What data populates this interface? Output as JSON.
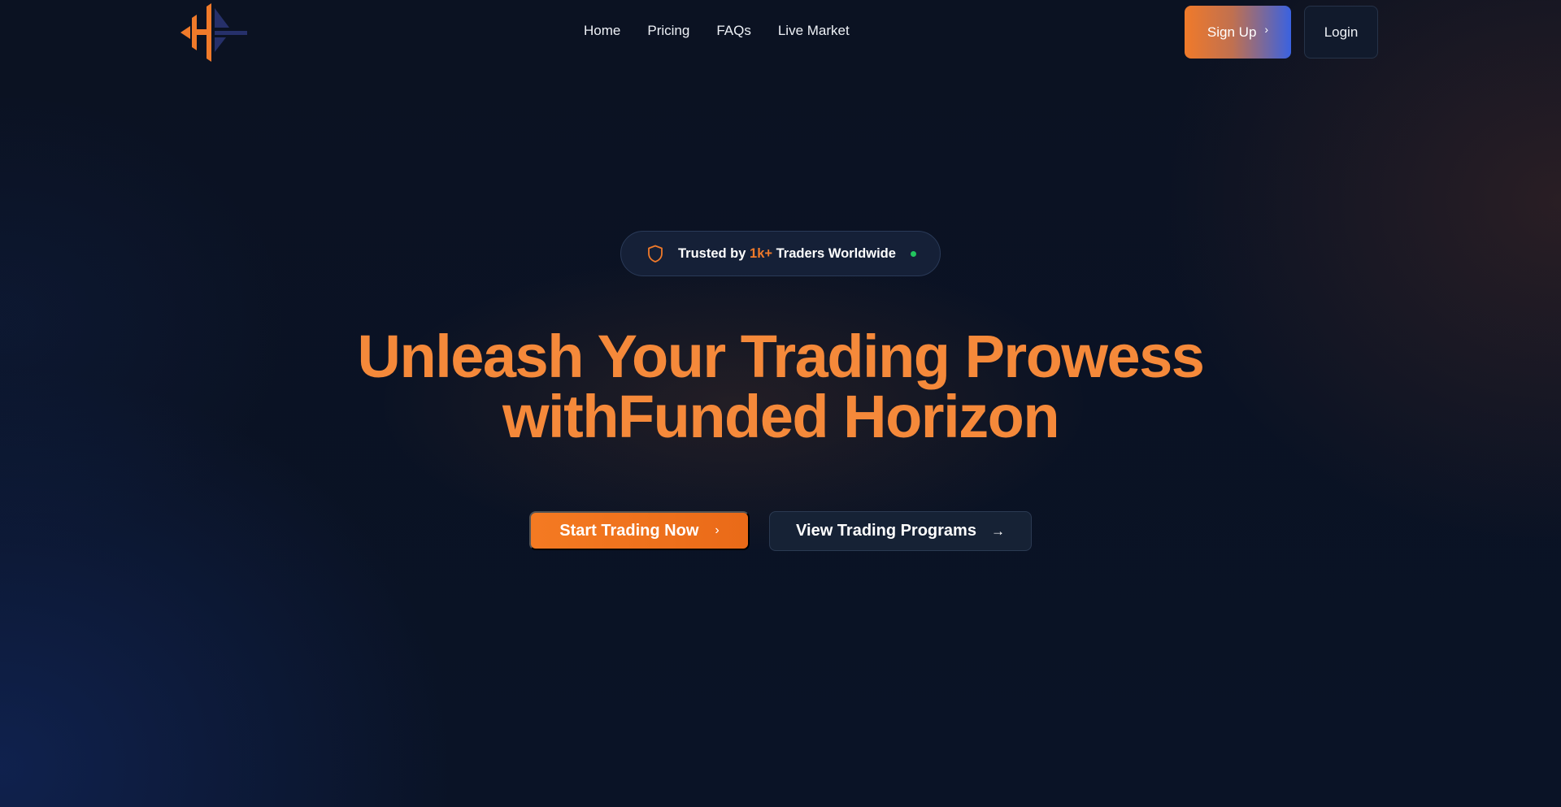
{
  "nav": {
    "logo_name": "funded-horizon-logo",
    "links": [
      {
        "label": "Home"
      },
      {
        "label": "Pricing"
      },
      {
        "label": "FAQs"
      },
      {
        "label": "Live Market"
      }
    ],
    "signup_label": "Sign Up",
    "signup_icon": "chevron-right-icon",
    "login_label": "Login"
  },
  "badge": {
    "prefix": "Trusted by ",
    "highlight": "1k+",
    "suffix": " Traders Worldwide",
    "icon": "shield-icon",
    "status_color": "#22c55e"
  },
  "hero": {
    "title_line1": "Unleash Your Trading Prowess",
    "title_line2": "withFunded Horizon"
  },
  "cta": {
    "primary_label": "Start Trading Now",
    "primary_icon": "chevron-right-icon",
    "secondary_label": "View Trading Programs",
    "secondary_icon": "arrow-right-icon"
  },
  "colors": {
    "accent": "#f07a2a",
    "background": "#0b1222",
    "secondary_accent": "#3a62e0"
  }
}
